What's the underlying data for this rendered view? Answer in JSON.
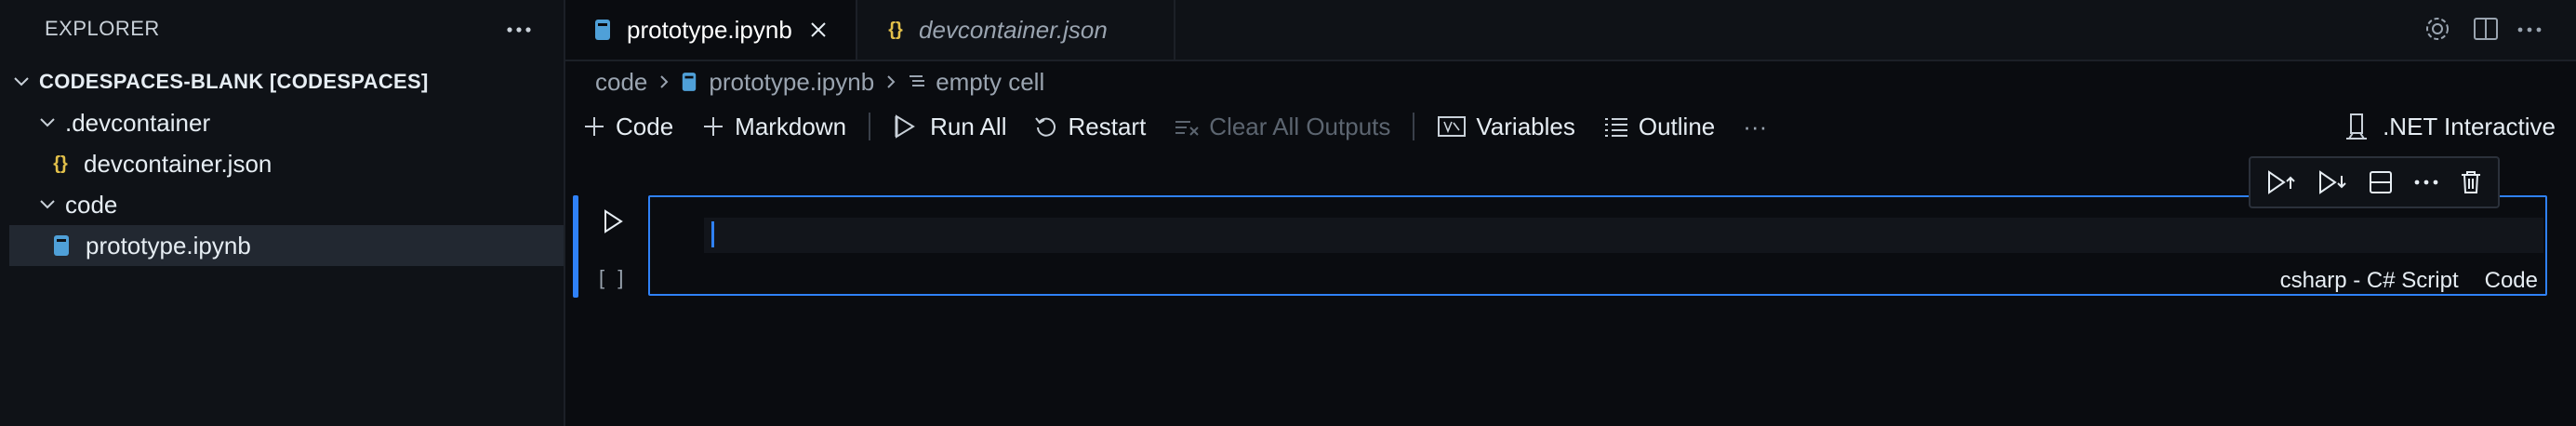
{
  "sidebar": {
    "title": "EXPLORER",
    "root": "CODESPACES-BLANK [CODESPACES]",
    "items": [
      {
        "label": ".devcontainer",
        "type": "folder"
      },
      {
        "label": "devcontainer.json",
        "type": "json-file",
        "icon_text": "{}"
      },
      {
        "label": "code",
        "type": "folder"
      },
      {
        "label": "prototype.ipynb",
        "type": "notebook-file",
        "selected": true
      }
    ]
  },
  "tabs": [
    {
      "label": "prototype.ipynb",
      "active": true
    },
    {
      "label": "devcontainer.json",
      "active": false,
      "icon_text": "{}"
    }
  ],
  "breadcrumb": [
    "code",
    "prototype.ipynb",
    "empty cell"
  ],
  "toolbar": {
    "code": "Code",
    "markdown": "Markdown",
    "run_all": "Run All",
    "restart": "Restart",
    "clear_outputs": "Clear All Outputs",
    "variables": "Variables",
    "outline": "Outline",
    "more": "···"
  },
  "kernel": ".NET Interactive",
  "cell": {
    "execution_count": "[ ]",
    "language": "csharp - C# Script",
    "cell_type": "Code"
  },
  "colors": {
    "accent": "#2f81f7",
    "json_icon": "#e2c04a",
    "notebook_icon": "#4fa0d8"
  }
}
